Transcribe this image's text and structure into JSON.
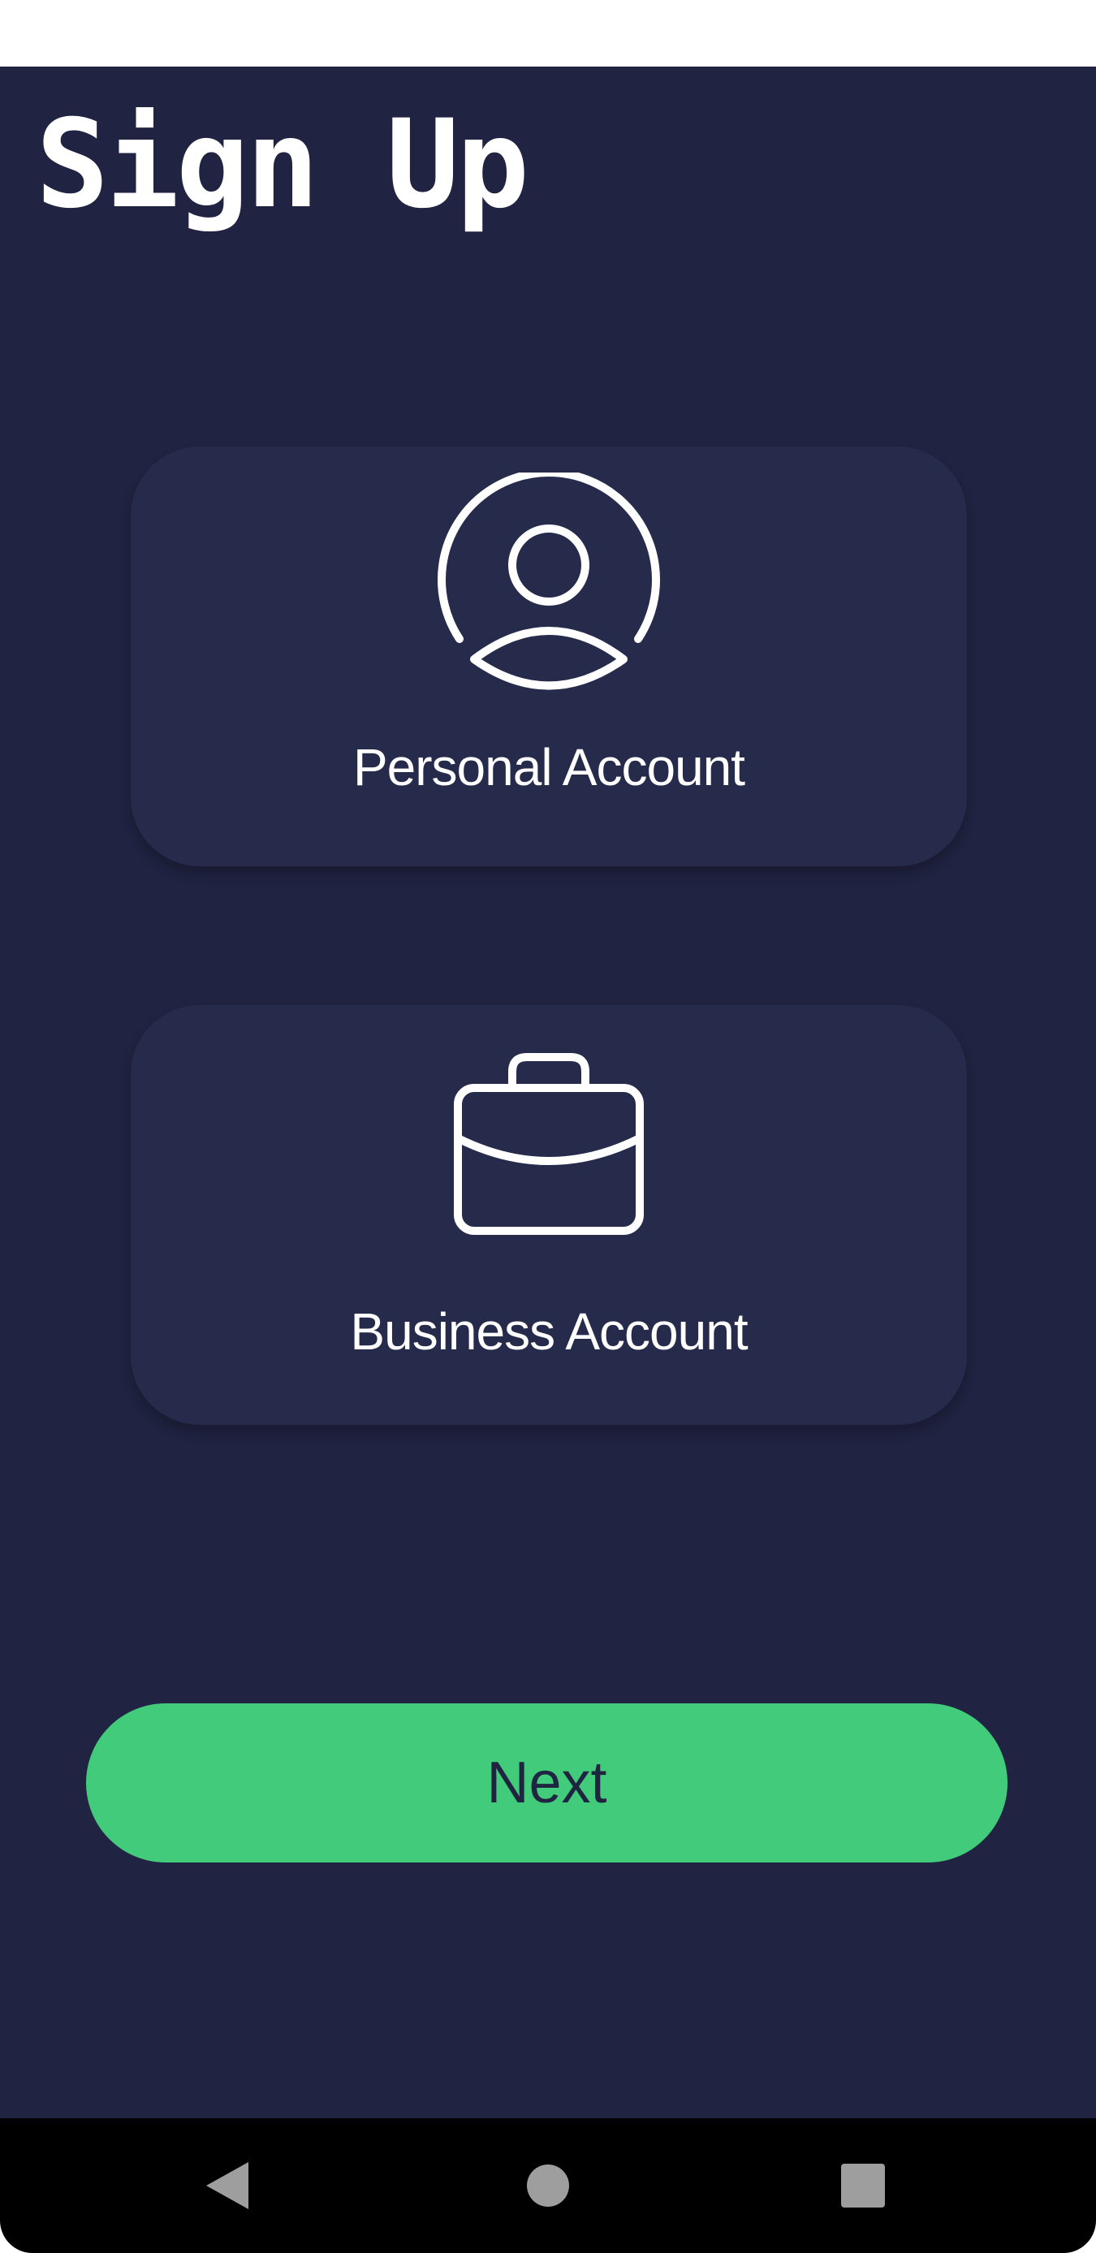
{
  "screen": {
    "title": "Sign Up"
  },
  "account_options": [
    {
      "label": "Personal Account",
      "icon": "user-circle-icon"
    },
    {
      "label": "Business Account",
      "icon": "briefcase-icon"
    }
  ],
  "actions": {
    "next_label": "Next"
  },
  "system_nav": {
    "back_icon": "back-triangle-icon",
    "home_icon": "home-circle-icon",
    "recents_icon": "recents-square-icon"
  },
  "colors": {
    "background": "#202341",
    "card": "#272b4b",
    "accent": "#41cb7b",
    "text": "#ffffff",
    "button_text": "#1f2441"
  }
}
